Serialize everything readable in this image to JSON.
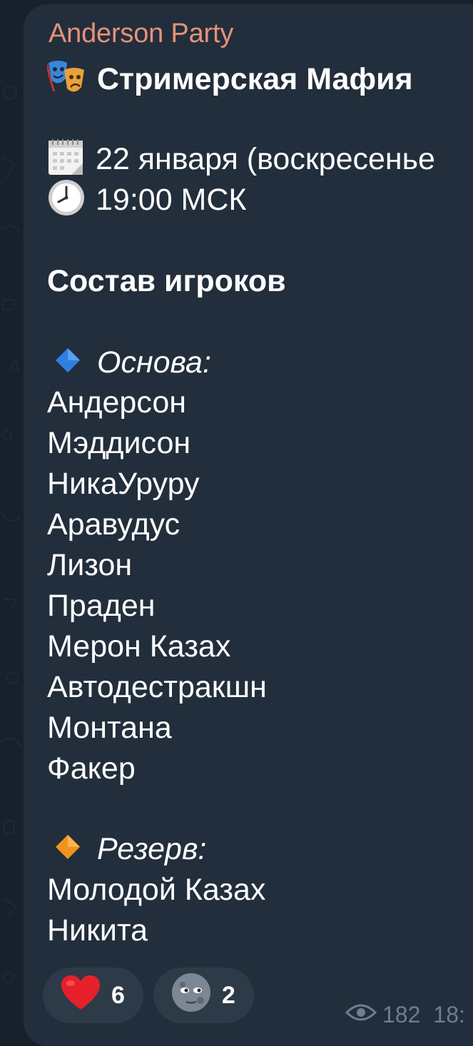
{
  "message": {
    "sender": "Anderson Party",
    "title": "Стримерская Мафия",
    "date_line": "22 января (воскресенье",
    "time_line": "19:00 МСК",
    "lineup_heading": "Состав игроков",
    "main_label": "Основа:",
    "main_players": [
      "Андерсон",
      "Мэддисон",
      "НикаУруру",
      "Аравудус",
      "Лизон",
      "Праден",
      "Мерон Казах",
      "Автодестракшн",
      "Монтана",
      "Факер"
    ],
    "reserve_label": "Резерв:",
    "reserve_players": [
      "Молодой Казах",
      "Никита"
    ]
  },
  "icons": {
    "title": "theater-masks-icon",
    "date": "calendar-icon",
    "time": "clock-icon",
    "main": "blue-diamond-icon",
    "reserve": "orange-diamond-icon",
    "views": "eye-icon"
  },
  "reactions": [
    {
      "emoji": "heart",
      "count": "6"
    },
    {
      "emoji": "moon-face",
      "count": "2"
    }
  ],
  "meta": {
    "views": "182",
    "time": "18:"
  },
  "colors": {
    "background": "#17212b",
    "bubble": "#222e3b",
    "sender": "#e5917a",
    "text": "#ffffff",
    "meta": "#6d7f8f",
    "reaction_bg": "#2d3a48"
  }
}
